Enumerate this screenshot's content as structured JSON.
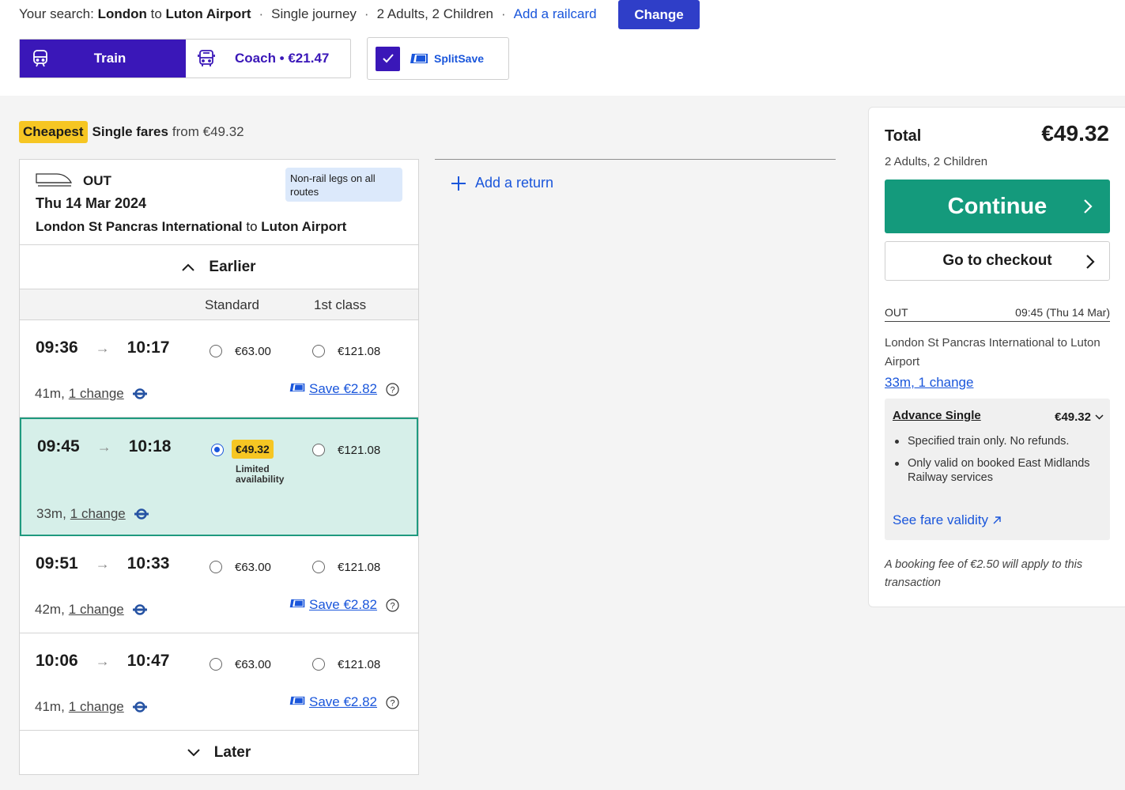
{
  "search": {
    "prefix": "Your search:",
    "from": "London",
    "to_word": "to",
    "to": "Luton Airport",
    "journey_type": "Single journey",
    "passengers": "2 Adults, 2 Children",
    "railcard_link": "Add a railcard",
    "change_label": "Change"
  },
  "modes": {
    "train_label": "Train",
    "coach_label": "Coach • €21.47",
    "splitsave_label": "SplitSave"
  },
  "cheapest": {
    "badge": "Cheapest",
    "fares_label": "Single fares",
    "from_text": "from €49.32"
  },
  "outbound": {
    "direction": "OUT",
    "non_rail_note": "Non-rail legs on all routes",
    "date": "Thu 14 Mar 2024",
    "origin": "London St Pancras International",
    "to_word": "to",
    "destination": "Luton Airport",
    "earlier_label": "Earlier",
    "later_label": "Later",
    "col_standard": "Standard",
    "col_first": "1st class",
    "rows": [
      {
        "depart": "09:36",
        "arrive": "10:17",
        "standard": "€63.00",
        "first": "€121.08",
        "duration": "41m,",
        "changes": "1 change",
        "save": "Save €2.82"
      },
      {
        "depart": "09:45",
        "arrive": "10:18",
        "standard": "€49.32",
        "first": "€121.08",
        "duration": "33m,",
        "changes": "1 change",
        "limited": "Limited availability"
      },
      {
        "depart": "09:51",
        "arrive": "10:33",
        "standard": "€63.00",
        "first": "€121.08",
        "duration": "42m,",
        "changes": "1 change",
        "save": "Save €2.82"
      },
      {
        "depart": "10:06",
        "arrive": "10:47",
        "standard": "€63.00",
        "first": "€121.08",
        "duration": "41m,",
        "changes": "1 change",
        "save": "Save €2.82"
      }
    ]
  },
  "return": {
    "add_label": "Add a return"
  },
  "summary": {
    "total_label": "Total",
    "total_amount": "€49.32",
    "passengers": "2 Adults, 2 Children",
    "continue_label": "Continue",
    "checkout_label": "Go to checkout",
    "out_label": "OUT",
    "out_time": "09:45 (Thu 14 Mar)",
    "route": "London St Pancras International to Luton Airport",
    "duration": "33m, 1 change",
    "fare_name": "Advance Single",
    "fare_price": "€49.32",
    "conditions": [
      "Specified train only. No refunds.",
      "Only valid on booked East Midlands Railway services"
    ],
    "fare_validity": "See fare validity",
    "booking_fee": "A booking fee of €2.50 will apply to this transaction"
  },
  "colors": {
    "brand_purple": "#3a17b8",
    "link_blue": "#1a56db",
    "continue_green": "#149a7c",
    "selected_row": "#d6efe9",
    "badge_yellow": "#f6c623"
  }
}
